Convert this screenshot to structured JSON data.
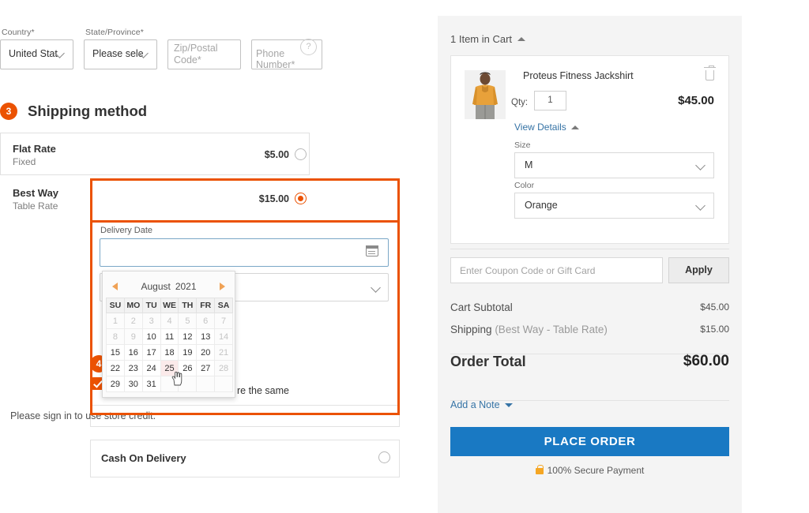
{
  "address": {
    "country": {
      "label": "Country",
      "required": "*",
      "value": "United Stat"
    },
    "state": {
      "label": "State/Province",
      "required": "*",
      "value": "Please sele"
    },
    "zip": {
      "line1": "Zip/Postal",
      "line2": "Code",
      "required": "*"
    },
    "phone": {
      "placeholder": "Phone Number",
      "required": "*",
      "help_icon": "question-circle-icon"
    }
  },
  "shipping_step": {
    "number": "3",
    "title": "Shipping method",
    "options": [
      {
        "name": "Flat Rate",
        "sub": "Fixed",
        "price": "$5.00",
        "selected": false
      },
      {
        "name": "Best Way",
        "sub": "Table Rate",
        "price": "$15.00",
        "selected": true
      }
    ]
  },
  "delivery": {
    "label": "Delivery Date",
    "value": "",
    "icon": "calendar-icon"
  },
  "datepicker": {
    "month": "August",
    "year": "2021",
    "prev_icon": "triangle-left-icon",
    "next_icon": "triangle-right-icon",
    "weekdays": [
      "SU",
      "MO",
      "TU",
      "WE",
      "TH",
      "FR",
      "SA"
    ],
    "weeks": [
      [
        {
          "d": "1",
          "state": "dim"
        },
        {
          "d": "2",
          "state": "dim"
        },
        {
          "d": "3",
          "state": "dim"
        },
        {
          "d": "4",
          "state": "dim"
        },
        {
          "d": "5",
          "state": "dim"
        },
        {
          "d": "6",
          "state": "dim"
        },
        {
          "d": "7",
          "state": "dim"
        }
      ],
      [
        {
          "d": "8",
          "state": "dim"
        },
        {
          "d": "9",
          "state": "dim"
        },
        {
          "d": "10",
          "state": "on"
        },
        {
          "d": "11",
          "state": "on"
        },
        {
          "d": "12",
          "state": "on"
        },
        {
          "d": "13",
          "state": "on"
        },
        {
          "d": "14",
          "state": "dim"
        }
      ],
      [
        {
          "d": "15",
          "state": "on"
        },
        {
          "d": "16",
          "state": "on"
        },
        {
          "d": "17",
          "state": "on"
        },
        {
          "d": "18",
          "state": "on"
        },
        {
          "d": "19",
          "state": "on"
        },
        {
          "d": "20",
          "state": "on"
        },
        {
          "d": "21",
          "state": "dim"
        }
      ],
      [
        {
          "d": "22",
          "state": "on"
        },
        {
          "d": "23",
          "state": "on"
        },
        {
          "d": "24",
          "state": "on"
        },
        {
          "d": "25",
          "state": "hover"
        },
        {
          "d": "26",
          "state": "on"
        },
        {
          "d": "27",
          "state": "on"
        },
        {
          "d": "28",
          "state": "dim"
        }
      ],
      [
        {
          "d": "29",
          "state": "on"
        },
        {
          "d": "30",
          "state": "on"
        },
        {
          "d": "31",
          "state": "on"
        },
        {
          "d": "",
          "state": "blank"
        },
        {
          "d": "",
          "state": "blank"
        },
        {
          "d": "",
          "state": "blank"
        },
        {
          "d": "",
          "state": "blank"
        }
      ]
    ],
    "hovered_day": "25"
  },
  "payment_step": {
    "number": "4",
    "billing_same_text": "re the same",
    "store_credit_text": "Please sign in to use store credit.",
    "cod_label": "Cash On Delivery"
  },
  "summary": {
    "header": "1 Item in Cart",
    "header_caret": "caret-up-icon",
    "item": {
      "name": "Proteus Fitness Jackshirt",
      "qty_label": "Qty:",
      "qty_value": "1",
      "price": "$45.00",
      "remove_icon": "trash-icon",
      "view_details": "View Details",
      "view_details_caret": "caret-up-icon",
      "options": [
        {
          "label": "Size",
          "value": "M"
        },
        {
          "label": "Color",
          "value": "Orange"
        }
      ]
    },
    "coupon": {
      "placeholder": "Enter Coupon Code or Gift Card",
      "apply_label": "Apply"
    },
    "totals": [
      {
        "label": "Cart Subtotal",
        "note": "",
        "value": "$45.00"
      },
      {
        "label": "Shipping",
        "note": "(Best Way - Table Rate)",
        "value": "$15.00"
      }
    ],
    "order_total_label": "Order Total",
    "order_total_value": "$60.00",
    "add_note": "Add a Note",
    "add_note_caret": "caret-down-icon",
    "place_order": "PLACE ORDER",
    "secure_text": "100% Secure Payment",
    "secure_icon": "lock-icon"
  },
  "colors": {
    "accent_orange": "#eb5202",
    "link_blue": "#3573a5",
    "button_blue": "#1979c3",
    "panel_bg": "#f4f4f4"
  }
}
